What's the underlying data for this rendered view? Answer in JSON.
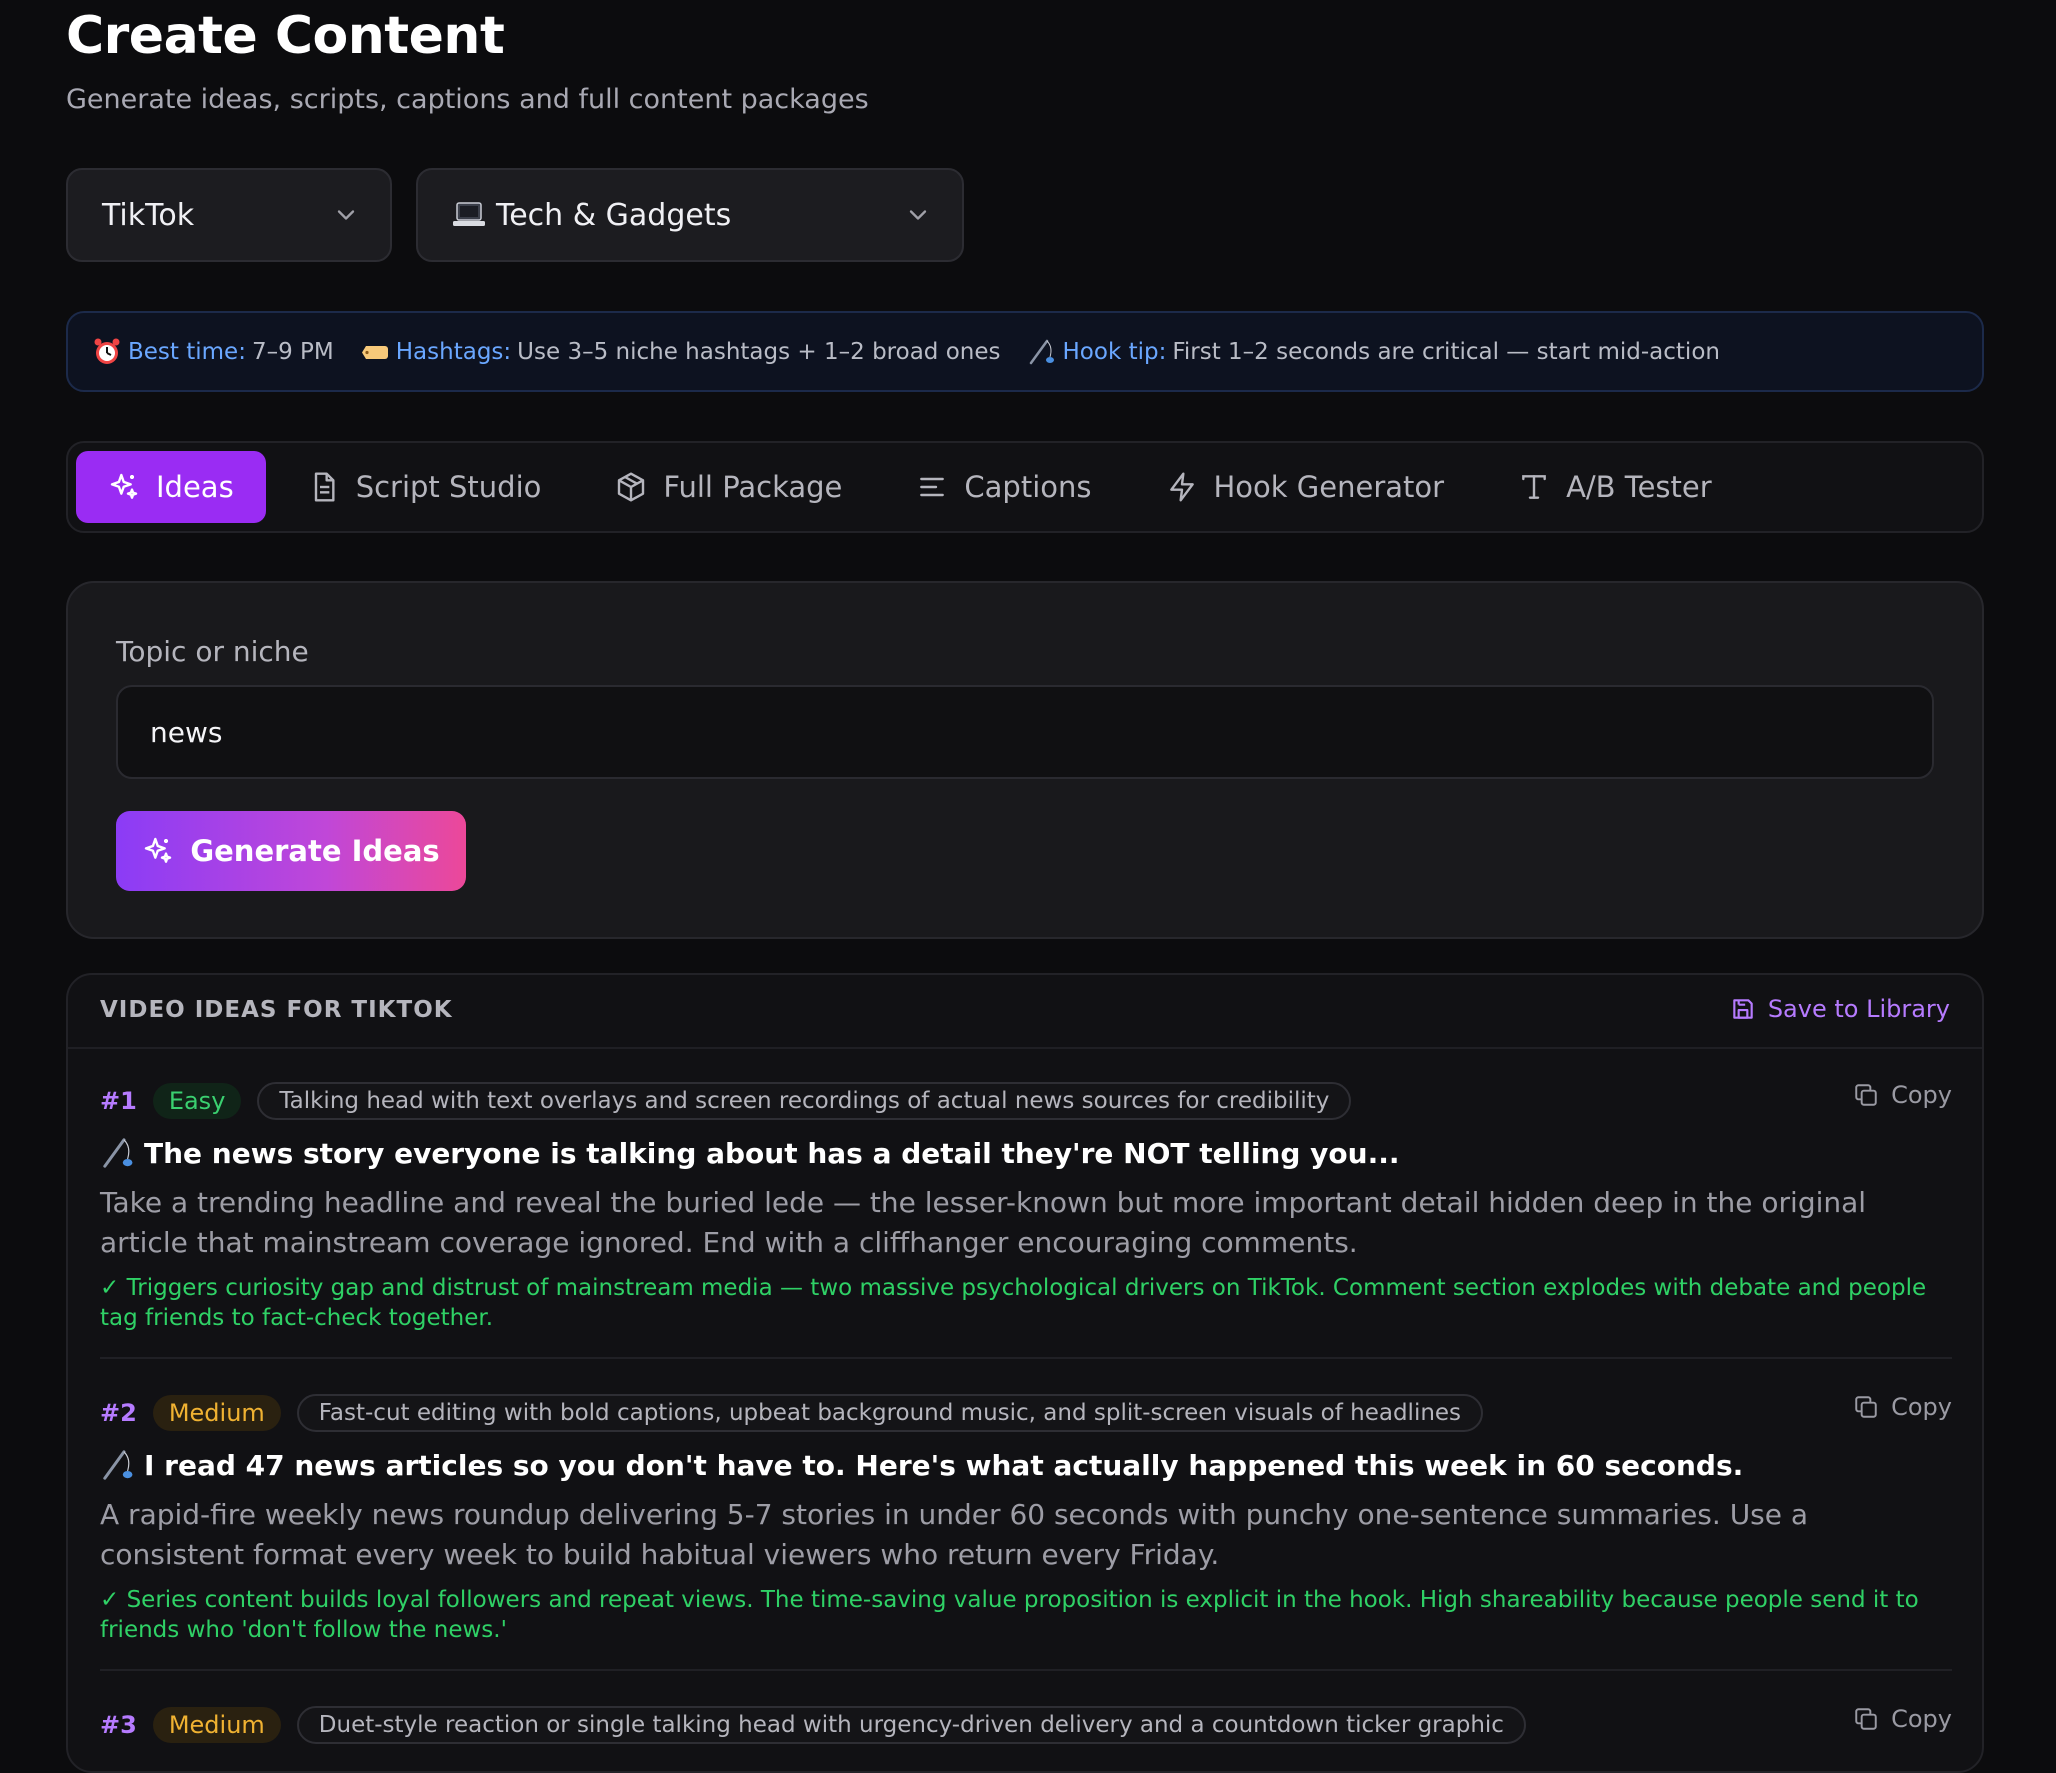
{
  "header": {
    "title": "Create Content",
    "subtitle": "Generate ideas, scripts, captions and full content packages"
  },
  "selects": {
    "platform": "TikTok",
    "niche": "Tech & Gadgets"
  },
  "tips": {
    "best_time_label": "Best time:",
    "best_time_value": "7–9 PM",
    "hashtags_label": "Hashtags:",
    "hashtags_value": "Use 3–5 niche hashtags + 1–2 broad ones",
    "hook_label": "Hook tip:",
    "hook_value": "First 1–2 seconds are critical — start mid-action"
  },
  "tabs": [
    {
      "label": "Ideas",
      "icon": "sparkles-icon",
      "active": true
    },
    {
      "label": "Script Studio",
      "icon": "document-icon"
    },
    {
      "label": "Full Package",
      "icon": "package-icon"
    },
    {
      "label": "Captions",
      "icon": "lines-icon"
    },
    {
      "label": "Hook Generator",
      "icon": "bolt-icon"
    },
    {
      "label": "A/B Tester",
      "icon": "type-icon"
    }
  ],
  "form": {
    "label": "Topic or niche",
    "value": "news",
    "button": "Generate Ideas"
  },
  "results": {
    "title": "VIDEO IDEAS FOR TIKTOK",
    "save_label": "Save to Library",
    "copy_label": "Copy",
    "ideas": [
      {
        "num": "#1",
        "difficulty": "Easy",
        "format": "Talking head with text overlays and screen recordings of actual news sources for credibility",
        "hook": "The news story everyone is talking about has a detail they're NOT telling you...",
        "description": "Take a trending headline and reveal the buried lede — the lesser-known but more important detail hidden deep in the original article that mainstream coverage ignored. End with a cliffhanger encouraging comments.",
        "why": "✓ Triggers curiosity gap and distrust of mainstream media — two massive psychological drivers on TikTok. Comment section explodes with debate and people tag friends to fact-check together."
      },
      {
        "num": "#2",
        "difficulty": "Medium",
        "format": "Fast-cut editing with bold captions, upbeat background music, and split-screen visuals of headlines",
        "hook": "I read 47 news articles so you don't have to. Here's what actually happened this week in 60 seconds.",
        "description": "A rapid-fire weekly news roundup delivering 5-7 stories in under 60 seconds with punchy one-sentence summaries. Use a consistent format every week to build habitual viewers who return every Friday.",
        "why": "✓ Series content builds loyal followers and repeat views. The time-saving value proposition is explicit in the hook. High shareability because people send it to friends who 'don't follow the news.'"
      },
      {
        "num": "#3",
        "difficulty": "Medium",
        "format": "Duet-style reaction or single talking head with urgency-driven delivery and a countdown ticker graphic"
      }
    ]
  }
}
